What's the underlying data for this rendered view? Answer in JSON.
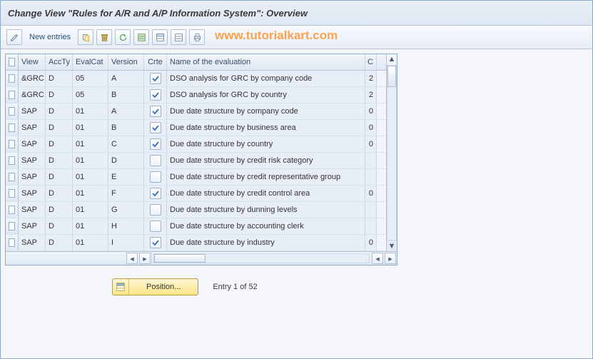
{
  "title": "Change View \"Rules for A/R and A/P Information System\": Overview",
  "watermark": "www.tutorialkart.com",
  "toolbar": {
    "new_entries": "New entries"
  },
  "columns": {
    "view": "View",
    "accty": "AccTy",
    "evalcat": "EvalCat",
    "version": "Version",
    "crte": "Crte",
    "name": "Name of the evaluation",
    "c": "C"
  },
  "rows": [
    {
      "view": "&GRC",
      "accty": "D",
      "evalcat": "05",
      "version": "A",
      "crte": true,
      "name": "DSO analysis for GRC by company code",
      "c": "2"
    },
    {
      "view": "&GRC",
      "accty": "D",
      "evalcat": "05",
      "version": "B",
      "crte": true,
      "name": "DSO analysis for GRC by country",
      "c": "2"
    },
    {
      "view": "SAP",
      "accty": "D",
      "evalcat": "01",
      "version": "A",
      "crte": true,
      "name": "Due date structure by company code",
      "c": "0"
    },
    {
      "view": "SAP",
      "accty": "D",
      "evalcat": "01",
      "version": "B",
      "crte": true,
      "name": "Due date structure by business area",
      "c": "0"
    },
    {
      "view": "SAP",
      "accty": "D",
      "evalcat": "01",
      "version": "C",
      "crte": true,
      "name": "Due date structure by country",
      "c": "0"
    },
    {
      "view": "SAP",
      "accty": "D",
      "evalcat": "01",
      "version": "D",
      "crte": false,
      "name": "Due date structure by credit risk category",
      "c": ""
    },
    {
      "view": "SAP",
      "accty": "D",
      "evalcat": "01",
      "version": "E",
      "crte": false,
      "name": "Due date structure by credit representative group",
      "c": ""
    },
    {
      "view": "SAP",
      "accty": "D",
      "evalcat": "01",
      "version": "F",
      "crte": true,
      "name": "Due date structure by credit control area",
      "c": "0"
    },
    {
      "view": "SAP",
      "accty": "D",
      "evalcat": "01",
      "version": "G",
      "crte": false,
      "name": "Due date structure by dunning levels",
      "c": ""
    },
    {
      "view": "SAP",
      "accty": "D",
      "evalcat": "01",
      "version": "H",
      "crte": false,
      "name": "Due date structure by accounting clerk",
      "c": ""
    },
    {
      "view": "SAP",
      "accty": "D",
      "evalcat": "01",
      "version": "I",
      "crte": true,
      "name": "Due date structure by industry",
      "c": "0"
    }
  ],
  "footer": {
    "position_label": "Position...",
    "entry_text": "Entry 1 of 52"
  }
}
